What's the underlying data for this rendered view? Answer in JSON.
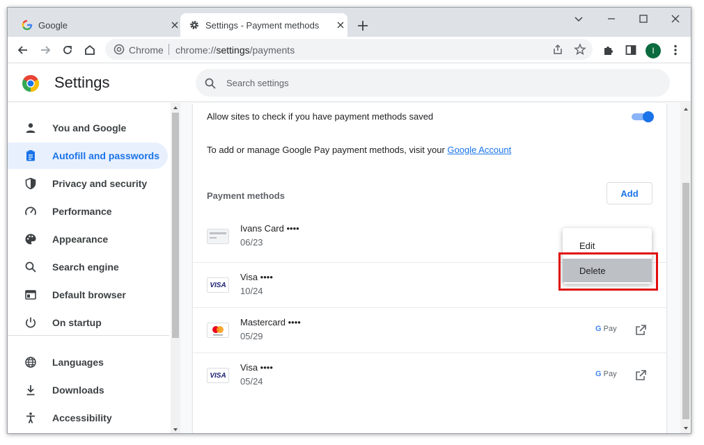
{
  "tabs": [
    {
      "title": "Google",
      "icon": "google-g-icon"
    },
    {
      "title": "Settings - Payment methods",
      "icon": "gear-icon"
    }
  ],
  "omnibox": {
    "site_chip": "Chrome",
    "url_scheme": "chrome://",
    "url_host": "settings",
    "url_path": "/payments"
  },
  "profile_initial": "I",
  "settings": {
    "title": "Settings",
    "search_placeholder": "Search settings"
  },
  "sidebar": {
    "items": [
      {
        "label": "You and Google",
        "icon": "person-icon"
      },
      {
        "label": "Autofill and passwords",
        "icon": "clipboard-icon",
        "active": true
      },
      {
        "label": "Privacy and security",
        "icon": "shield-icon"
      },
      {
        "label": "Performance",
        "icon": "speedometer-icon"
      },
      {
        "label": "Appearance",
        "icon": "palette-icon"
      },
      {
        "label": "Search engine",
        "icon": "search-icon"
      },
      {
        "label": "Default browser",
        "icon": "browser-window-icon"
      },
      {
        "label": "On startup",
        "icon": "power-icon"
      },
      {
        "label": "Languages",
        "icon": "globe-icon"
      },
      {
        "label": "Downloads",
        "icon": "download-icon"
      },
      {
        "label": "Accessibility",
        "icon": "accessibility-icon"
      }
    ]
  },
  "main": {
    "allow_label": "Allow sites to check if you have payment methods saved",
    "manage_prefix": "To add or manage Google Pay payment methods, visit your ",
    "manage_link": "Google Account",
    "heading": "Payment methods",
    "add_label": "Add",
    "payment_methods": [
      {
        "name": "Ivans Card ••••",
        "expiry": "06/23",
        "icon": "generic-card-icon",
        "gpay": false
      },
      {
        "name": "Visa ••••",
        "expiry": "10/24",
        "icon": "visa-card-icon",
        "gpay": false
      },
      {
        "name": "Mastercard ••••",
        "expiry": "05/29",
        "icon": "mastercard-icon",
        "gpay": true
      },
      {
        "name": "Visa ••••",
        "expiry": "05/24",
        "icon": "visa-card-icon",
        "gpay": true
      }
    ],
    "gpay_g": "G",
    "gpay_text": " Pay",
    "visa_text": "VISA"
  },
  "context_menu": {
    "edit_label": "Edit",
    "delete_label": "Delete"
  },
  "colors": {
    "accent": "#1a73e8",
    "active_nav_bg": "#e8f0fe",
    "highlight": "#e00e0e",
    "avatar": "#0b6b3e"
  }
}
